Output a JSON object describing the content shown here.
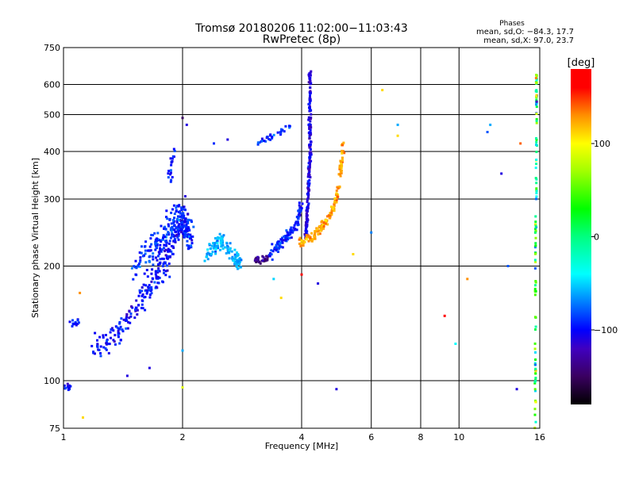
{
  "chart_data": {
    "type": "scatter",
    "title": "Tromsø 20180206 11:02:00−11:03:43",
    "subtitle": "RwPretec (8p)",
    "stats": {
      "heading": "Phases",
      "line_o": "mean, sd,O:  −84.3, 17.7",
      "line_x": "mean, sd,X:  97.0, 23.7"
    },
    "xlabel": "Frequency [MHz]",
    "ylabel": "Stationary phase Virtual Height [km]",
    "xscale": "log",
    "yscale": "log",
    "xlim": [
      1,
      16
    ],
    "ylim": [
      75,
      750
    ],
    "xticks": [
      1,
      2,
      4,
      6,
      8,
      10,
      16
    ],
    "xtick_labels": [
      "1",
      "2",
      "4",
      "6",
      "8",
      "10",
      "16"
    ],
    "yticks": [
      75,
      100,
      200,
      300,
      400,
      500,
      600,
      750
    ],
    "ytick_labels": [
      "75",
      "100",
      "200",
      "300",
      "400",
      "500",
      "600",
      "750"
    ],
    "grid_x": [
      2,
      4,
      6,
      8,
      10
    ],
    "grid_y": [
      100,
      200,
      300,
      400,
      500,
      600
    ],
    "colorbar": {
      "label": "[deg]",
      "range": [
        -180,
        180
      ],
      "ticks": [
        100,
        0,
        -100
      ],
      "tick_labels": [
        "100",
        "0",
        "−100"
      ]
    },
    "traces": [
      {
        "name": "low-echo",
        "phase": -105,
        "spread": 0.02,
        "n": 14,
        "path": [
          [
            1.0,
            97
          ],
          [
            1.05,
            96
          ]
        ]
      },
      {
        "name": "low-echo-2",
        "phase": -95,
        "spread": 0.02,
        "n": 14,
        "path": [
          [
            1.04,
            140
          ],
          [
            1.1,
            142
          ]
        ]
      },
      {
        "name": "o-trace-lower",
        "phase": -100,
        "spread": 0.06,
        "n": 260,
        "path": [
          [
            1.2,
            125
          ],
          [
            1.35,
            130
          ],
          [
            1.5,
            150
          ],
          [
            1.65,
            175
          ],
          [
            1.8,
            200
          ],
          [
            1.9,
            240
          ],
          [
            2.05,
            260
          ]
        ]
      },
      {
        "name": "o-trace-cloud",
        "phase": -90,
        "spread": 0.07,
        "n": 220,
        "path": [
          [
            1.5,
            200
          ],
          [
            1.7,
            220
          ],
          [
            1.85,
            250
          ],
          [
            2.0,
            280
          ],
          [
            2.1,
            230
          ]
        ]
      },
      {
        "name": "o-trace-top",
        "phase": -95,
        "spread": 0.04,
        "n": 20,
        "path": [
          [
            1.85,
            330
          ],
          [
            1.9,
            400
          ]
        ]
      },
      {
        "name": "cluster-2.5",
        "phase": -60,
        "spread": 0.035,
        "n": 120,
        "path": [
          [
            2.3,
            215
          ],
          [
            2.5,
            235
          ],
          [
            2.7,
            210
          ],
          [
            2.8,
            205
          ]
        ]
      },
      {
        "name": "cluster-3.2",
        "phase": -135,
        "spread": 0.015,
        "n": 30,
        "path": [
          [
            3.05,
            207
          ],
          [
            3.3,
            210
          ]
        ]
      },
      {
        "name": "cluster-3.6",
        "phase": -95,
        "spread": 0.03,
        "n": 110,
        "path": [
          [
            3.3,
            215
          ],
          [
            3.5,
            225
          ],
          [
            3.7,
            240
          ],
          [
            3.9,
            260
          ],
          [
            4.0,
            290
          ]
        ]
      },
      {
        "name": "f-trace-o",
        "phase": -110,
        "spread": 0.02,
        "n": 200,
        "path": [
          [
            4.1,
            240
          ],
          [
            4.15,
            300
          ],
          [
            4.2,
            400
          ],
          [
            4.2,
            520
          ],
          [
            4.2,
            640
          ]
        ]
      },
      {
        "name": "f-trace-x",
        "phase": 125,
        "spread": 0.025,
        "n": 160,
        "path": [
          [
            3.95,
            230
          ],
          [
            4.3,
            240
          ],
          [
            4.6,
            260
          ],
          [
            4.85,
            290
          ],
          [
            5.0,
            340
          ],
          [
            5.1,
            420
          ]
        ]
      },
      {
        "name": "upper-3.5",
        "phase": -90,
        "spread": 0.015,
        "n": 30,
        "path": [
          [
            3.1,
            420
          ],
          [
            3.4,
            440
          ],
          [
            3.8,
            470
          ]
        ]
      },
      {
        "name": "edge-15.7",
        "phase": 20,
        "spread": 0.01,
        "n": 110,
        "path": [
          [
            15.6,
            75
          ],
          [
            15.6,
            200
          ],
          [
            15.7,
            400
          ],
          [
            15.7,
            650
          ]
        ]
      }
    ],
    "points": [
      [
        6.4,
        580,
        110
      ],
      [
        7.0,
        470,
        -60
      ],
      [
        7.0,
        440,
        110
      ],
      [
        6.0,
        245,
        -70
      ],
      [
        9.2,
        148,
        160
      ],
      [
        9.8,
        125,
        -40
      ],
      [
        10.5,
        185,
        130
      ],
      [
        12.0,
        470,
        -60
      ],
      [
        11.8,
        450,
        -80
      ],
      [
        12.8,
        350,
        -110
      ],
      [
        14.0,
        95,
        -110
      ],
      [
        14.3,
        420,
        140
      ],
      [
        13.3,
        200,
        -80
      ],
      [
        4.9,
        95,
        -110
      ],
      [
        4.0,
        190,
        160
      ],
      [
        3.4,
        185,
        -50
      ],
      [
        3.55,
        165,
        110
      ],
      [
        2.0,
        490,
        -150
      ],
      [
        2.05,
        470,
        -110
      ],
      [
        2.4,
        420,
        -90
      ],
      [
        2.6,
        430,
        -110
      ],
      [
        1.12,
        80,
        110
      ],
      [
        1.1,
        170,
        130
      ],
      [
        2.0,
        120,
        -60
      ],
      [
        2.0,
        96,
        90
      ],
      [
        1.45,
        103,
        -110
      ],
      [
        1.65,
        108,
        -110
      ],
      [
        4.4,
        180,
        -110
      ],
      [
        5.4,
        215,
        110
      ]
    ]
  }
}
